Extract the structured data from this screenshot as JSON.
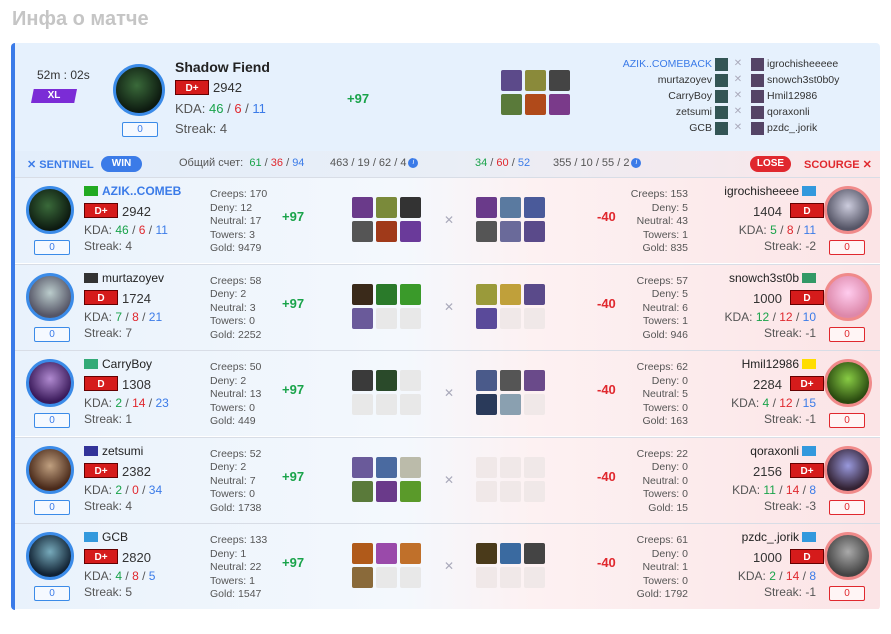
{
  "page_title": "Инфа о матче",
  "colors": {
    "accent": "#3b7be8",
    "win": "#3b7be8",
    "lose": "#e0282e",
    "rank": "#d51b1b",
    "xl": "#7b2cd6",
    "positive": "#19a34a"
  },
  "summary": {
    "duration": "52m : 02s",
    "mode": "XL",
    "hero": "Shadow Fiend",
    "rank": "D+",
    "mmr": "2942",
    "kda_label": "KDA:",
    "kills": "46",
    "deaths": "6",
    "assists": "11",
    "sep": "/",
    "streak_label": "Streak:",
    "streak": "4",
    "count": "0",
    "delta": "+97",
    "roster": [
      {
        "left": "AZIK..COMEBACK",
        "right": "igrochisheeeee"
      },
      {
        "left": "murtazoyev",
        "right": "snowch3st0b0y"
      },
      {
        "left": "CarryBoy",
        "right": "Hmil12986"
      },
      {
        "left": "zetsumi",
        "right": "qoraxonli"
      },
      {
        "left": "GCB",
        "right": "pzdc_.jorik"
      }
    ]
  },
  "bar": {
    "sentinel": "SENTINEL",
    "win": "WIN",
    "score_label": "Общий счет:",
    "score": [
      "61",
      "36",
      "94"
    ],
    "stat_a": "463 / 19 / 62 / 4",
    "kda_b": [
      "34",
      "60",
      "52"
    ],
    "stat_c": "355 / 10 / 55 / 2",
    "lose": "LOSE",
    "scourge": "SCOURGE",
    "info": "i"
  },
  "labels": {
    "kda": "KDA:",
    "streak": "Streak:",
    "creeps": "Creeps:",
    "deny": "Deny:",
    "neutral": "Neutral:",
    "towers": "Towers:",
    "gold": "Gold:",
    "sep": "/"
  },
  "rows": [
    {
      "l": {
        "name": "AZIK..COMEB",
        "mmr": "2942",
        "rank": "D+",
        "k": "46",
        "d": "6",
        "a": "11",
        "streak": "4",
        "count": "0",
        "creeps": "170",
        "deny": "12",
        "neutral": "17",
        "towers": "3",
        "gold": "9479",
        "delta": "+97"
      },
      "r": {
        "name": "igrochisheeee",
        "mmr": "1404",
        "rank": "D",
        "k": "5",
        "d": "8",
        "a": "11",
        "streak": "-2",
        "count": "0",
        "creeps": "153",
        "deny": "5",
        "neutral": "43",
        "towers": "1",
        "gold": "835",
        "delta": "-40"
      }
    },
    {
      "l": {
        "name": "murtazoyev",
        "mmr": "1724",
        "rank": "D",
        "k": "7",
        "d": "8",
        "a": "21",
        "streak": "7",
        "count": "0",
        "creeps": "58",
        "deny": "2",
        "neutral": "3",
        "towers": "0",
        "gold": "2252",
        "delta": "+97"
      },
      "r": {
        "name": "snowch3st0b",
        "mmr": "1000",
        "rank": "D",
        "k": "12",
        "d": "12",
        "a": "10",
        "streak": "-1",
        "count": "0",
        "creeps": "57",
        "deny": "5",
        "neutral": "6",
        "towers": "1",
        "gold": "946",
        "delta": "-40"
      }
    },
    {
      "l": {
        "name": "CarryBoy",
        "mmr": "1308",
        "rank": "D",
        "k": "2",
        "d": "14",
        "a": "23",
        "streak": "1",
        "count": "0",
        "creeps": "50",
        "deny": "2",
        "neutral": "13",
        "towers": "0",
        "gold": "449",
        "delta": "+97"
      },
      "r": {
        "name": "Hmil12986",
        "mmr": "2284",
        "rank": "D+",
        "k": "4",
        "d": "12",
        "a": "15",
        "streak": "-1",
        "count": "0",
        "creeps": "62",
        "deny": "0",
        "neutral": "5",
        "towers": "0",
        "gold": "163",
        "delta": "-40"
      }
    },
    {
      "l": {
        "name": "zetsumi",
        "mmr": "2382",
        "rank": "D+",
        "k": "2",
        "d": "0",
        "a": "34",
        "streak": "4",
        "count": "0",
        "creeps": "52",
        "deny": "2",
        "neutral": "7",
        "towers": "0",
        "gold": "1738",
        "delta": "+97"
      },
      "r": {
        "name": "qoraxonli",
        "mmr": "2156",
        "rank": "D+",
        "k": "11",
        "d": "14",
        "a": "8",
        "streak": "-3",
        "count": "0",
        "creeps": "22",
        "deny": "0",
        "neutral": "0",
        "towers": "0",
        "gold": "15",
        "delta": "-40"
      }
    },
    {
      "l": {
        "name": "GCB",
        "mmr": "2820",
        "rank": "D+",
        "k": "4",
        "d": "8",
        "a": "5",
        "streak": "5",
        "count": "0",
        "creeps": "133",
        "deny": "1",
        "neutral": "22",
        "towers": "1",
        "gold": "1547",
        "delta": "+97"
      },
      "r": {
        "name": "pzdc_.jorik",
        "mmr": "1000",
        "rank": "D",
        "k": "2",
        "d": "14",
        "a": "8",
        "streak": "-1",
        "count": "0",
        "creeps": "61",
        "deny": "0",
        "neutral": "1",
        "towers": "0",
        "gold": "1792",
        "delta": "-40"
      }
    }
  ]
}
